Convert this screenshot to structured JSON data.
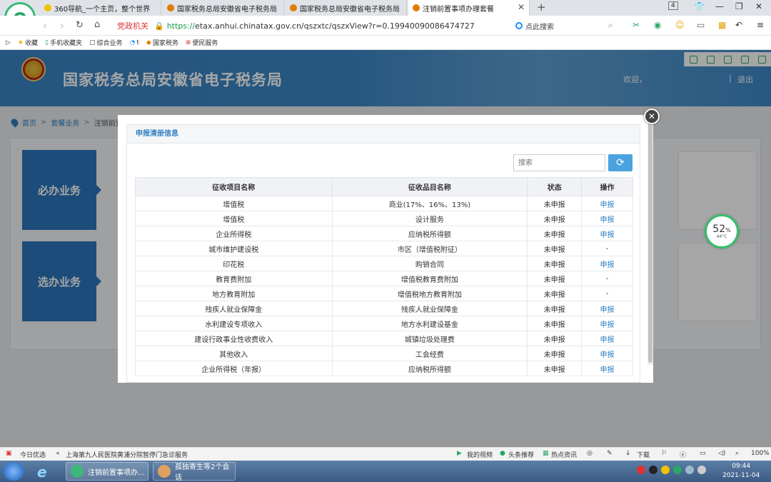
{
  "browser": {
    "tabs": [
      {
        "label": "360导航_一个主页，整个世界",
        "active": false
      },
      {
        "label": "国家税务总局安徽省电子税务局",
        "active": false
      },
      {
        "label": "国家税务总局安徽省电子税务局",
        "active": false
      },
      {
        "label": "注销前置事项办理套餐",
        "active": true
      }
    ],
    "tab_count": "4",
    "address": {
      "gov_label": "党政机关",
      "scheme": "https://",
      "url_rest": "etax.anhui.chinatax.gov.cn/qszxtc/qszxView?r=0.19940090086474727"
    },
    "search_label": "点此搜索",
    "bookmarks": [
      "收藏",
      "手机收藏夹",
      "综合业务",
      "t",
      "国家税务",
      "便民服务"
    ]
  },
  "site": {
    "title": "国家税务总局安徽省电子税务局",
    "welcome": "欢迎，",
    "separator": "|",
    "logout": "退出"
  },
  "breadcrumb": [
    "首页",
    "套餐业务",
    "注销前置"
  ],
  "content": {
    "block1": "必办业务",
    "block2": "选办业务"
  },
  "modal": {
    "panel_title": "申报清册信息",
    "search_placeholder": "搜索",
    "columns": [
      "征收项目名称",
      "征收品目名称",
      "状态",
      "操作"
    ],
    "rows": [
      [
        "增值税",
        "商业(17%、16%、13%)",
        "未申报",
        "申报"
      ],
      [
        "增值税",
        "设计服务",
        "未申报",
        "申报"
      ],
      [
        "企业所得税",
        "应纳税所得额",
        "未申报",
        "申报"
      ],
      [
        "城市维护建设税",
        "市区（增值税附征）",
        "未申报",
        "-"
      ],
      [
        "印花税",
        "购销合同",
        "未申报",
        "申报"
      ],
      [
        "教育费附加",
        "增值税教育费附加",
        "未申报",
        "-"
      ],
      [
        "地方教育附加",
        "增值税地方教育附加",
        "未申报",
        "-"
      ],
      [
        "残疾人就业保障金",
        "残疾人就业保障金",
        "未申报",
        "申报"
      ],
      [
        "水利建设专项收入",
        "地方水利建设基金",
        "未申报",
        "申报"
      ],
      [
        "建设行政事业性收费收入",
        "城镇垃圾处理费",
        "未申报",
        "申报"
      ],
      [
        "其他收入",
        "工会经费",
        "未申报",
        "申报"
      ],
      [
        "企业所得税（年报）",
        "应纳税所得额",
        "未申报",
        "申报"
      ]
    ]
  },
  "widget": {
    "percent": "52",
    "percent_sign": "%",
    "temp": "44°C"
  },
  "statusbar": {
    "today": "今日优选",
    "news": "上海第九人民医院黄浦分院暂停门急诊服务",
    "video": "我的视频",
    "headline": "头条推荐",
    "hot": "热点资讯",
    "download": "下载",
    "zoom": "100%"
  },
  "taskbar": {
    "item1": "注销前置事项办...",
    "item2": "孤独寄生等2个会话",
    "time": "09:44",
    "date": "2021-11-04"
  },
  "colors": {
    "primary": "#2b76bc",
    "header": "#3a85c4",
    "link": "#2f7fc1"
  }
}
